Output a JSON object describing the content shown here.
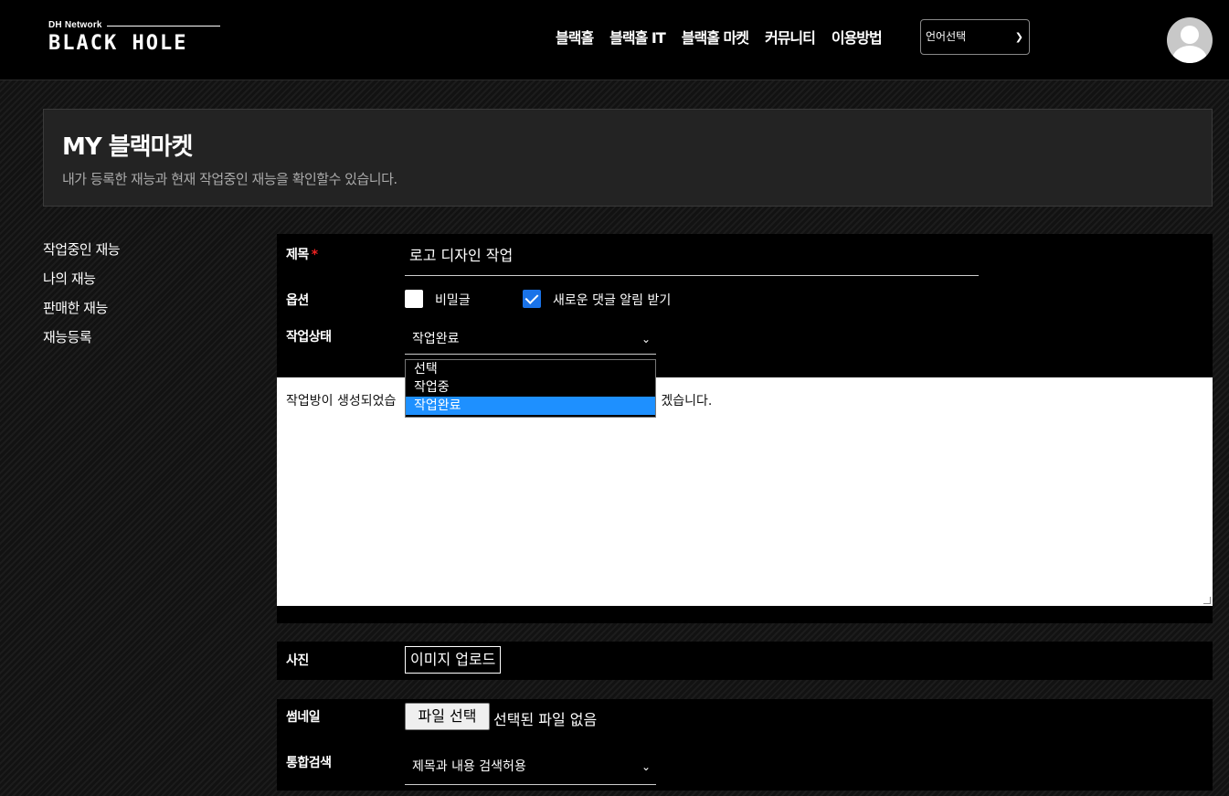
{
  "logo": {
    "small": "DH Network",
    "big": "BLACK HOLE"
  },
  "nav": {
    "items": [
      "블랙홀",
      "블랙홀 IT",
      "블랙홀 마켓",
      "커뮤니티",
      "이용방법"
    ],
    "language_select": "언어선택"
  },
  "banner": {
    "title": "MY 블랙마켓",
    "subtitle": "내가 등록한 재능과 현재 작업중인 재능을 확인할수 있습니다."
  },
  "sidebar": {
    "items": [
      {
        "label": "작업중인 재능"
      },
      {
        "label": "나의 재능"
      },
      {
        "label": "판매한 재능"
      },
      {
        "label": "재능등록"
      }
    ]
  },
  "form": {
    "title_label": "제목",
    "required_mark": "*",
    "title_value": "로고 디자인 작업",
    "options_label": "옵션",
    "secret_label": "비밀글",
    "secret_checked": false,
    "notify_label": "새로운 댓글 알림 받기",
    "notify_checked": true,
    "status_label": "작업상태",
    "status_value": "작업완료",
    "status_options": [
      "선택",
      "작업중",
      "작업완료"
    ],
    "content_left": "작업방이 생성되었습",
    "content_right": "겠습니다.",
    "photo_label": "사진",
    "image_upload_button": "이미지 업로드",
    "thumbnail_label": "썸네일",
    "file_button": "파일 선택",
    "file_status": "선택된 파일 없음",
    "search_label": "통합검색",
    "search_value": "제목과 내용 검색허용"
  },
  "colors": {
    "accent": "#1e90ff",
    "checkbox": "#1a73e8",
    "required": "#ee2222"
  }
}
